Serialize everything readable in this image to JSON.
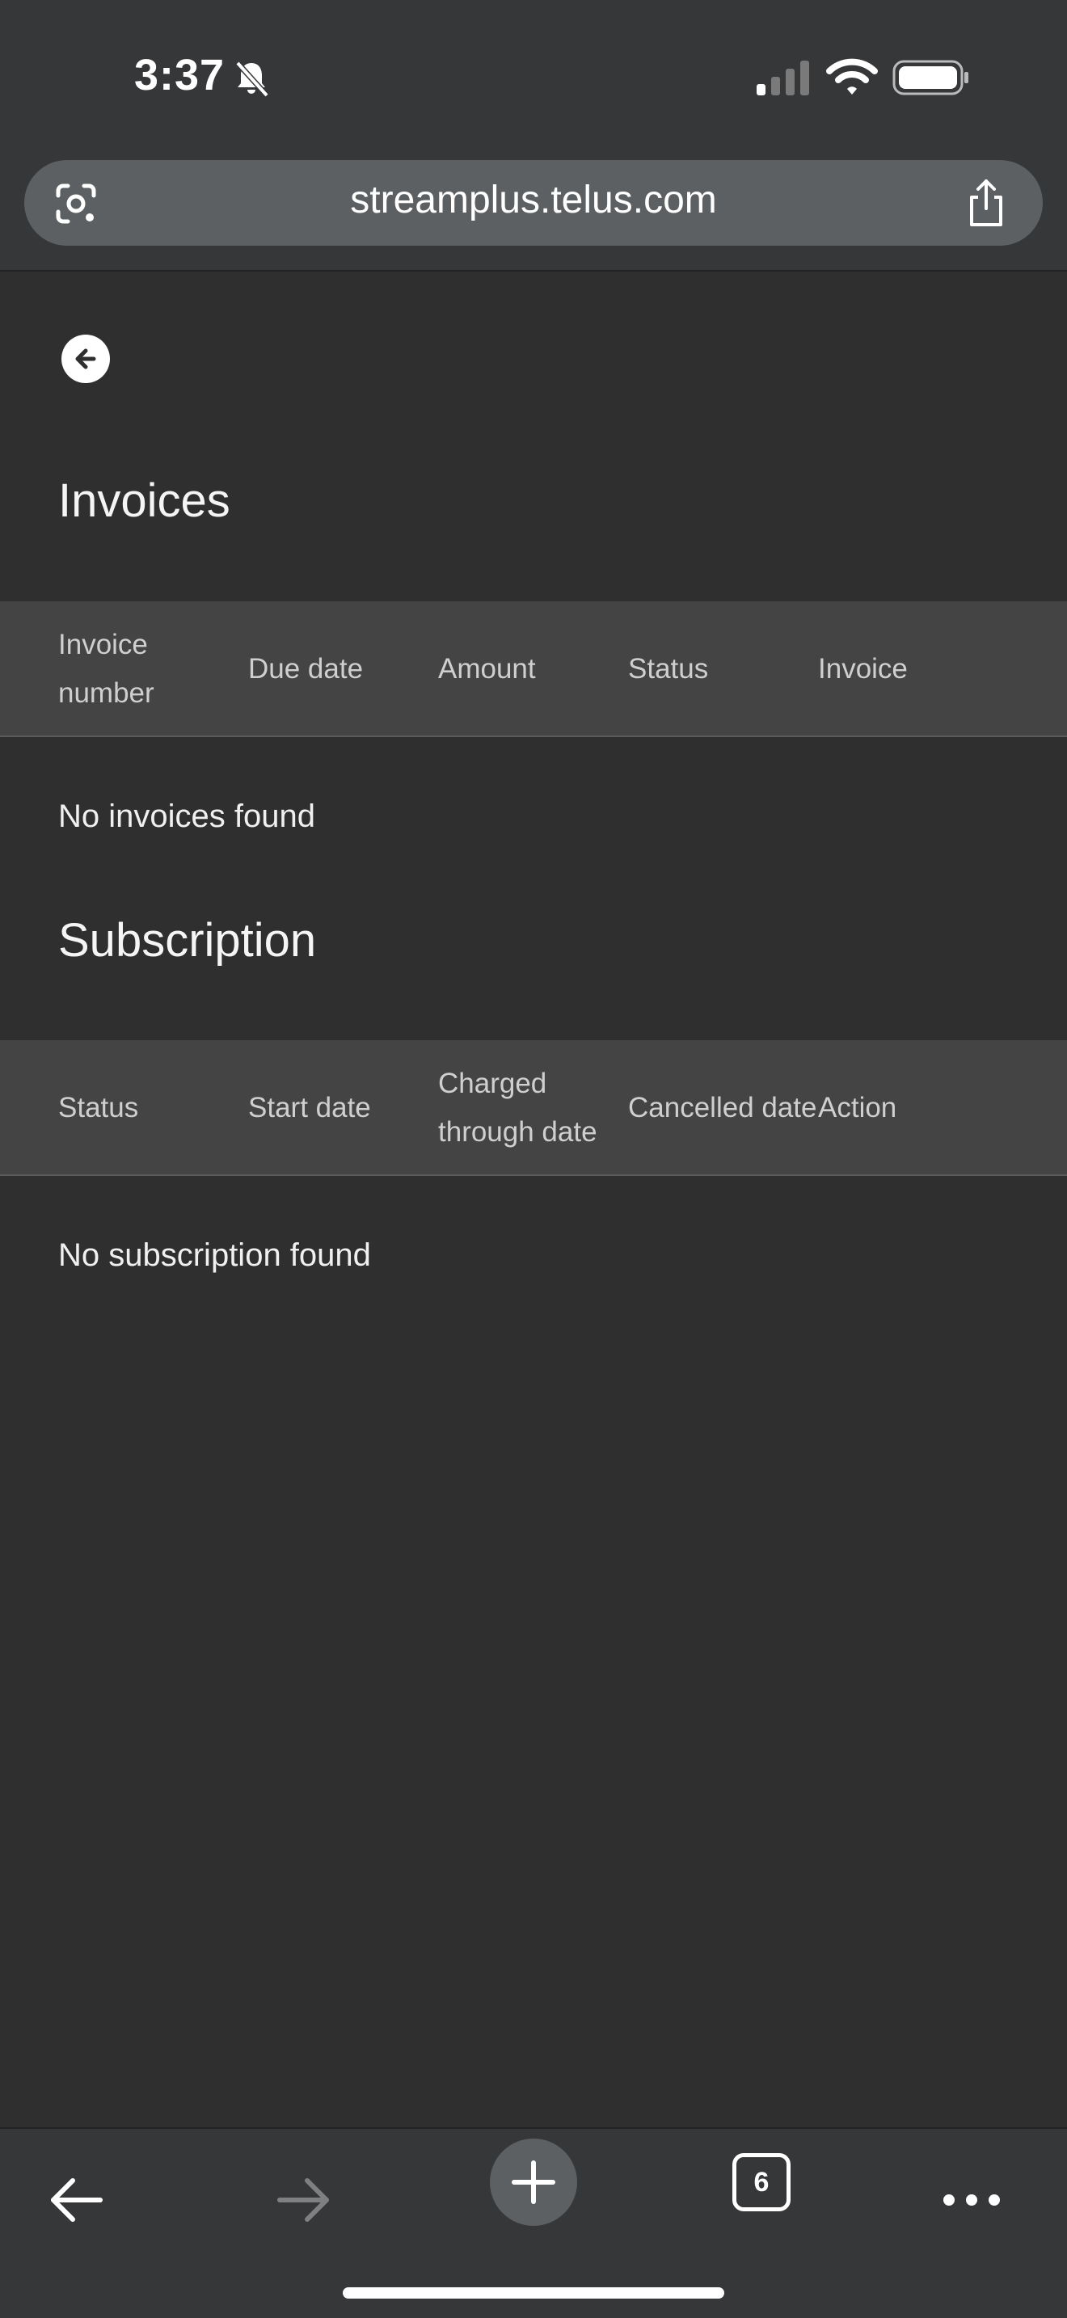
{
  "status_bar": {
    "time": "3:37"
  },
  "browser": {
    "url": "streamplus.telus.com",
    "tab_count": "6"
  },
  "invoices": {
    "title": "Invoices",
    "columns": [
      "Invoice number",
      "Due date",
      "Amount",
      "Status",
      "Invoice"
    ],
    "empty_message": "No invoices found"
  },
  "subscription": {
    "title": "Subscription",
    "columns": [
      "Status",
      "Start date",
      "Charged through date",
      "Cancelled date",
      "Action"
    ],
    "empty_message": "No subscription found"
  },
  "colors": {
    "page_background": "#2f2f2f",
    "chrome_background": "#353738",
    "table_header_background": "#444444"
  }
}
